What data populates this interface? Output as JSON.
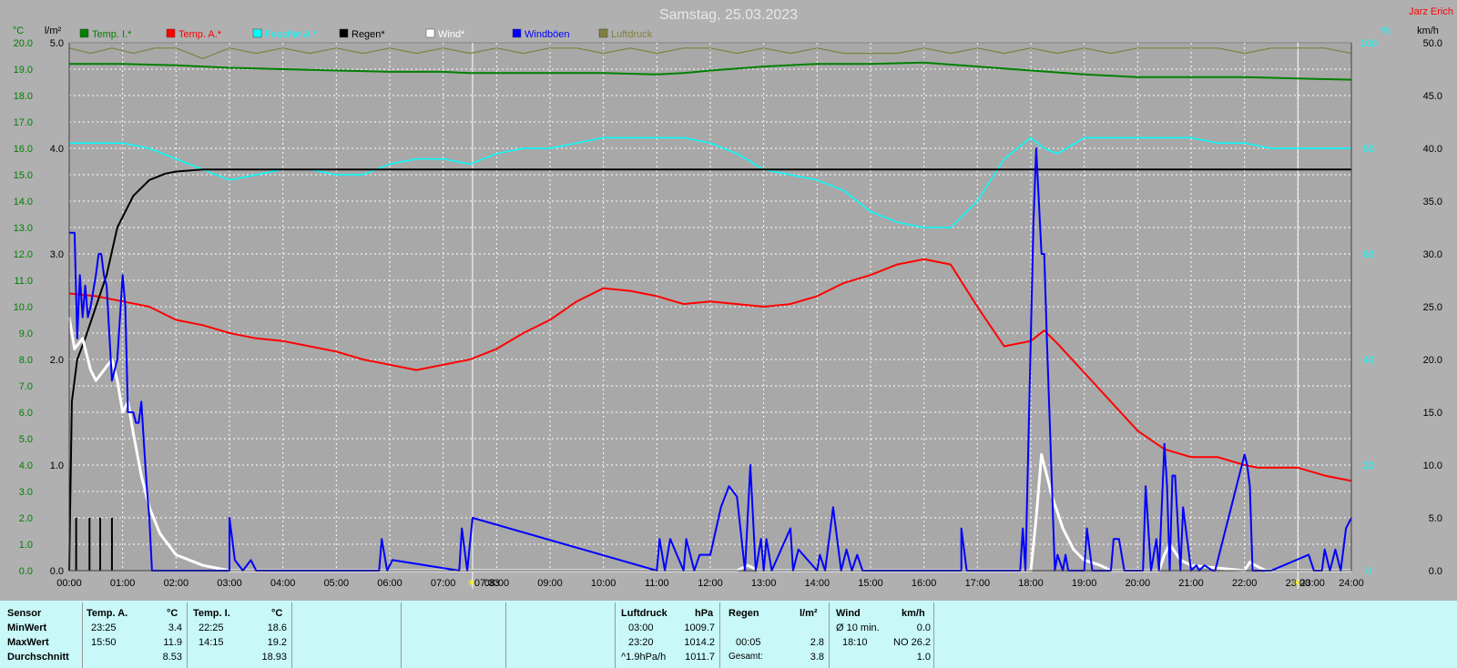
{
  "title": "Samstag, 25.03.2023",
  "author": "Jarz Erich",
  "units": {
    "temp": "°C",
    "rain": "l/m²",
    "hum": "%",
    "wind": "km/h"
  },
  "chart_data": {
    "type": "line",
    "x_axis": {
      "range_h": [
        0,
        24
      ],
      "ticks": [
        "00:00",
        "01:00",
        "02:00",
        "03:00",
        "04:00",
        "05:00",
        "06:00",
        "07:00",
        "08:00",
        "09:00",
        "10:00",
        "11:00",
        "12:00",
        "13:00",
        "14:00",
        "15:00",
        "16:00",
        "17:00",
        "18:00",
        "19:00",
        "20:00",
        "21:00",
        "22:00",
        "23:00",
        "24:00"
      ]
    },
    "sun_markers": [
      {
        "time": "07:33",
        "h": 7.55
      },
      {
        "time": "23:00",
        "h": 23.0
      }
    ],
    "axes": {
      "temp": {
        "range": [
          0,
          20
        ],
        "ticks": [
          "0.0",
          "1.0",
          "2.0",
          "3.0",
          "4.0",
          "5.0",
          "6.0",
          "7.0",
          "8.0",
          "9.0",
          "10.0",
          "11.0",
          "12.0",
          "13.0",
          "14.0",
          "15.0",
          "16.0",
          "17.0",
          "18.0",
          "19.0",
          "20.0"
        ]
      },
      "rain": {
        "range": [
          0,
          5
        ],
        "ticks": [
          "0.0",
          "1.0",
          "2.0",
          "3.0",
          "4.0",
          "5.0"
        ]
      },
      "hum": {
        "range": [
          0,
          100
        ],
        "ticks": [
          "0",
          "20",
          "40",
          "60",
          "80",
          "100"
        ]
      },
      "wind": {
        "range": [
          0,
          50
        ],
        "ticks": [
          "0.0",
          "5.0",
          "10.0",
          "15.0",
          "20.0",
          "25.0",
          "30.0",
          "35.0",
          "40.0",
          "45.0",
          "50.0"
        ]
      }
    },
    "grid": true,
    "legend_position": "top",
    "series": [
      {
        "name": "Temp. I.*",
        "color": "#008000",
        "axis": "temp",
        "x": [
          0,
          1,
          2,
          3,
          4,
          5,
          6,
          7,
          7.5,
          8,
          9,
          10,
          11,
          11.5,
          12,
          13,
          14,
          15,
          16,
          17,
          18,
          19,
          20,
          21,
          22,
          23,
          24
        ],
        "y": [
          19.2,
          19.2,
          19.15,
          19.05,
          19.0,
          18.95,
          18.9,
          18.9,
          18.85,
          18.85,
          18.85,
          18.85,
          18.8,
          18.85,
          18.95,
          19.1,
          19.2,
          19.2,
          19.25,
          19.1,
          18.95,
          18.8,
          18.7,
          18.7,
          18.7,
          18.65,
          18.6
        ]
      },
      {
        "name": "Temp. A.*",
        "color": "#ff0000",
        "axis": "temp",
        "x": [
          0,
          0.5,
          1,
          1.5,
          2,
          2.5,
          3,
          3.5,
          4,
          4.5,
          5,
          5.5,
          6,
          6.5,
          7,
          7.5,
          8,
          8.5,
          9,
          9.5,
          10,
          10.5,
          11,
          11.5,
          12,
          12.5,
          13,
          13.5,
          14,
          14.5,
          15,
          15.5,
          16,
          16.5,
          17,
          17.5,
          18,
          18.25,
          18.5,
          19,
          19.5,
          20,
          20.5,
          21,
          21.5,
          22,
          22.25,
          22.5,
          23,
          23.5,
          24
        ],
        "y": [
          10.5,
          10.4,
          10.2,
          10.0,
          9.5,
          9.3,
          9.0,
          8.8,
          8.7,
          8.5,
          8.3,
          8.0,
          7.8,
          7.6,
          7.8,
          8.0,
          8.4,
          9.0,
          9.5,
          10.2,
          10.7,
          10.6,
          10.4,
          10.1,
          10.2,
          10.1,
          10.0,
          10.1,
          10.4,
          10.9,
          11.2,
          11.6,
          11.8,
          11.6,
          10.0,
          8.5,
          8.7,
          9.1,
          8.6,
          7.5,
          6.4,
          5.3,
          4.6,
          4.3,
          4.3,
          4.0,
          3.9,
          3.9,
          3.9,
          3.6,
          3.4
        ]
      },
      {
        "name": "Feuchte A.*",
        "color": "#00ffff",
        "axis": "hum",
        "x": [
          0,
          0.5,
          1,
          1.5,
          2,
          2.5,
          3,
          3.5,
          4,
          4.5,
          5,
          5.5,
          6,
          6.5,
          7,
          7.5,
          8,
          8.5,
          9,
          9.5,
          10,
          10.5,
          11,
          11.5,
          12,
          12.5,
          13,
          13.5,
          14,
          14.5,
          15,
          15.5,
          16,
          16.5,
          17,
          17.5,
          18,
          18.25,
          18.5,
          19,
          19.5,
          20,
          20.5,
          21,
          21.5,
          22,
          22.5,
          23,
          23.5,
          24
        ],
        "y": [
          81,
          81,
          81,
          80,
          78,
          76,
          74,
          75,
          76,
          76,
          75,
          75,
          77,
          78,
          78,
          77,
          79,
          80,
          80,
          81,
          82,
          82,
          82,
          82,
          81,
          79,
          76,
          75,
          74,
          72,
          68,
          66,
          65,
          65,
          70,
          78,
          82,
          80,
          79,
          82,
          82,
          82,
          82,
          82,
          81,
          81,
          80,
          80,
          80,
          80
        ]
      },
      {
        "name": "Regen*",
        "color": "#000000",
        "axis": "rain",
        "x": [
          0,
          0.05,
          0.15,
          0.3,
          0.5,
          0.7,
          0.9,
          1.2,
          1.5,
          1.8,
          2,
          2.5,
          3,
          24
        ],
        "y": [
          0,
          1.6,
          2.0,
          2.2,
          2.5,
          2.8,
          3.25,
          3.55,
          3.7,
          3.76,
          3.78,
          3.8,
          3.8,
          3.8
        ]
      },
      {
        "name": "Wind*",
        "color": "#ffffff",
        "axis": "wind",
        "x": [
          0,
          0.1,
          0.25,
          0.4,
          0.5,
          0.65,
          0.8,
          0.9,
          1.0,
          1.1,
          1.2,
          1.35,
          1.5,
          1.7,
          2,
          2.5,
          3,
          12.5,
          12.7,
          12.9,
          18.0,
          18.1,
          18.2,
          18.4,
          18.6,
          18.8,
          19,
          19.3,
          19.5,
          20.4,
          20.5,
          20.6,
          20.8,
          21,
          22,
          22.1,
          22.2,
          22.4,
          24
        ],
        "y": [
          24,
          21,
          22,
          19,
          18,
          19,
          20,
          18,
          15,
          16,
          13,
          9,
          6,
          3.5,
          1.5,
          0.5,
          0,
          0,
          0.5,
          0,
          0,
          5,
          11,
          7,
          4,
          2,
          1,
          0.5,
          0,
          0,
          1.5,
          2.5,
          1,
          0.5,
          0,
          0.8,
          0.5,
          0,
          0
        ]
      },
      {
        "name": "Windböen",
        "color": "#0000ff",
        "axis": "wind",
        "x": [
          0,
          0.05,
          0.1,
          0.15,
          0.2,
          0.25,
          0.3,
          0.35,
          0.4,
          0.5,
          0.55,
          0.6,
          0.65,
          0.7,
          0.8,
          0.9,
          1.0,
          1.05,
          1.1,
          1.15,
          1.2,
          1.25,
          1.3,
          1.35,
          1.4,
          1.45,
          1.5,
          1.55,
          3.0,
          3.0,
          3.1,
          3.25,
          3.4,
          3.5,
          5.8,
          5.85,
          5.95,
          6.05,
          7.3,
          7.35,
          7.45,
          7.55,
          11.0,
          11.05,
          11.15,
          11.25,
          11.5,
          11.55,
          11.7,
          11.8,
          12.0,
          12.2,
          12.35,
          12.5,
          12.65,
          12.75,
          12.85,
          12.95,
          13.0,
          13.05,
          13.15,
          13.5,
          13.55,
          13.65,
          14.0,
          14.05,
          14.15,
          14.3,
          14.45,
          14.55,
          14.65,
          14.75,
          14.85,
          16.7,
          16.7,
          16.8,
          16.9,
          17.8,
          17.85,
          17.9,
          18.05,
          18.1,
          18.15,
          18.2,
          18.25,
          18.3,
          18.45,
          18.5,
          18.6,
          18.65,
          18.7,
          19.0,
          19.05,
          19.15,
          19.5,
          19.55,
          19.65,
          19.75,
          20.1,
          20.15,
          20.25,
          20.35,
          20.4,
          20.5,
          20.55,
          20.6,
          20.65,
          20.7,
          20.8,
          20.85,
          21.0,
          21.1,
          21.15,
          21.25,
          21.4,
          21.45,
          22.0,
          22.05,
          22.1,
          22.15,
          22.2,
          22.5,
          23.2,
          23.3,
          23.35,
          23.45,
          23.5,
          23.6,
          23.7,
          23.8,
          23.9,
          24
        ],
        "y": [
          32,
          32,
          32,
          22,
          28,
          24,
          27,
          24,
          25,
          28,
          30,
          30,
          28,
          27,
          18,
          20,
          28,
          25,
          15,
          15,
          15,
          14,
          14,
          16,
          12,
          8,
          5,
          0,
          0,
          5,
          1,
          0,
          1,
          0,
          0,
          3,
          0,
          1,
          0,
          4,
          0,
          5,
          0,
          3,
          0,
          3,
          0,
          3,
          0,
          1.5,
          1.5,
          6,
          8,
          7,
          0,
          10,
          0,
          3,
          0,
          3,
          0,
          4,
          0,
          2,
          0,
          1.5,
          0,
          6,
          0,
          2,
          0,
          1.5,
          0,
          0,
          4,
          0,
          0,
          0,
          4,
          0,
          33,
          40,
          35,
          30,
          30,
          22,
          0,
          1.5,
          0,
          1.5,
          0,
          0,
          4,
          0,
          0,
          3,
          3,
          0,
          0,
          8,
          0,
          3,
          0,
          12,
          8,
          0,
          9,
          9,
          0,
          6,
          0,
          0.5,
          0,
          0.5,
          0,
          0,
          11,
          10,
          8,
          0,
          0,
          0,
          1.5,
          0,
          0,
          0,
          2,
          0,
          2,
          0,
          4,
          5
        ]
      },
      {
        "name": "Luftdruck",
        "color": "#808040",
        "axis": "hum",
        "x": [
          0,
          0.4,
          0.8,
          1.2,
          1.6,
          2,
          2.5,
          3,
          3.5,
          4,
          4.5,
          5,
          5.5,
          6,
          6.5,
          7,
          7.5,
          8,
          8.5,
          9,
          9.5,
          10,
          10.5,
          11,
          11.5,
          12,
          12.5,
          13,
          13.5,
          14,
          14.5,
          15,
          15.5,
          16,
          16.5,
          17,
          17.5,
          18,
          18.5,
          19,
          19.5,
          20,
          20.5,
          21,
          21.5,
          22,
          22.5,
          23,
          23.5,
          24
        ],
        "y": [
          99,
          98,
          99,
          98,
          99,
          99,
          97,
          99,
          98,
          99,
          98,
          99,
          98,
          99,
          98,
          99,
          98,
          99,
          98,
          99,
          99,
          98,
          99,
          98,
          99,
          99,
          98,
          99,
          98,
          99,
          98,
          98,
          98,
          99,
          98,
          99,
          98,
          99,
          98,
          99,
          98,
          99,
          99,
          99,
          99,
          98,
          99,
          99,
          99,
          98
        ]
      }
    ]
  },
  "table": {
    "col1": {
      "header": "Sensor",
      "rows": [
        "MinWert",
        "MaxWert",
        "Durchschnitt"
      ]
    },
    "temp_a": {
      "header": "Temp. A.",
      "unit": "°C",
      "times": [
        "23:25",
        "15:50",
        ""
      ],
      "values": [
        "3.4",
        "11.9",
        "8.53"
      ]
    },
    "temp_i": {
      "header": "Temp. I.",
      "unit": "°C",
      "times": [
        "22:25",
        "14:15",
        ""
      ],
      "values": [
        "18.6",
        "19.2",
        "18.93"
      ]
    },
    "pressure": {
      "header": "Luftdruck",
      "unit": "hPa",
      "times": [
        "03:00",
        "23:20",
        "^1.9hPa/h"
      ],
      "values": [
        "1009.7",
        "1014.2",
        "1011.7"
      ]
    },
    "rain": {
      "header": "Regen",
      "unit": "l/m²",
      "times": [
        "",
        "00:05",
        "Gesamt:"
      ],
      "values": [
        "",
        "2.8",
        "3.8"
      ]
    },
    "wind": {
      "header": "Wind",
      "unit": "km/h",
      "times": [
        "Ø 10 min.",
        "18:10",
        ""
      ],
      "values": [
        "0.0",
        "NO 26.2",
        "1.0"
      ]
    }
  }
}
